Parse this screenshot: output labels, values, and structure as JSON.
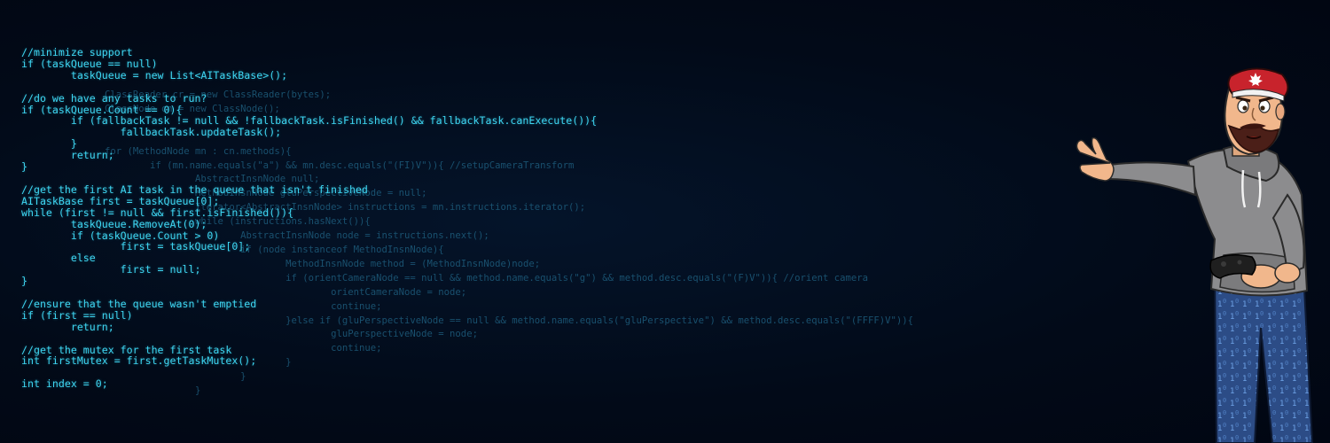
{
  "banner": {
    "colors": {
      "background": "#020a18",
      "code_front": "#3ed6f2",
      "code_back": "#1d5c7c",
      "cap": "#c8232c",
      "hoodie": "#8a8a8c",
      "jeans": "#2f4f8f"
    },
    "code_front_lines": [
      "//minimize support",
      "if (taskQueue == null)",
      "        taskQueue = new List<AITaskBase>();",
      "",
      "//do we have any tasks to run?",
      "if (taskQueue.Count == 0){",
      "        if (fallbackTask != null && !fallbackTask.isFinished() && fallbackTask.canExecute()){",
      "                fallbackTask.updateTask();",
      "        }",
      "        return;",
      "}",
      "",
      "//get the first AI task in the queue that isn't finished",
      "AITaskBase first = taskQueue[0];",
      "while (first != null && first.isFinished()){",
      "        taskQueue.RemoveAt(0);",
      "        if (taskQueue.Count > 0)",
      "                first = taskQueue[0];",
      "        else",
      "                first = null;",
      "}",
      "",
      "//ensure that the queue wasn't emptied",
      "if (first == null)",
      "        return;",
      "",
      "//get the mutex for the first task",
      "int firstMutex = first.getTaskMutex();",
      "",
      "int index = 0;"
    ],
    "code_back_lines": [
      "ClassReader cr = new ClassReader(bytes);",
      "ClassNode cn = new ClassNode();",
      "",
      "",
      "for (MethodNode mn : cn.methods){",
      "        if (mn.name.equals(\"a\") && mn.desc.equals(\"(FI)V\")){ //setupCameraTransform",
      "                AbstractInsnNode null;",
      "                MethodInsnNode gluPerspectiveNode = null;",
      "                Iterator<AbstractInsnNode> instructions = mn.instructions.iterator();",
      "                while (instructions.hasNext()){",
      "                        AbstractInsnNode node = instructions.next();",
      "                        if (node instanceof MethodInsnNode){",
      "                                MethodInsnNode method = (MethodInsnNode)node;",
      "                                if (orientCameraNode == null && method.name.equals(\"g\") && method.desc.equals(\"(F)V\")){ //orient camera",
      "                                        orientCameraNode = node;",
      "                                        continue;",
      "                                }else if (gluPerspectiveNode == null && method.name.equals(\"gluPerspective\") && method.desc.equals(\"(FFFF)V\")){",
      "                                        gluPerspectiveNode = node;",
      "                                        continue;",
      "                                }",
      "                        }",
      "                }"
    ]
  }
}
